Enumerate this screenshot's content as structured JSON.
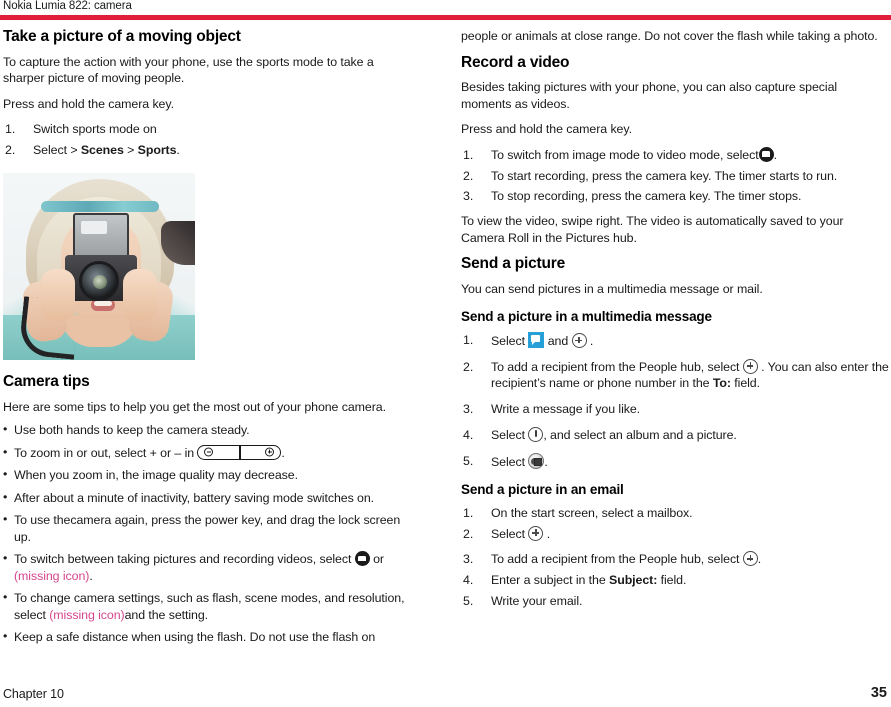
{
  "runhead": "Nokia Lumia 822: camera",
  "accent_color": "#e01f38",
  "missing_icon_color": "#d6468f",
  "left_column": {
    "heading": "Take a picture of a moving object",
    "intro": "To capture the action with your phone, use the sports mode to take a sharper picture of moving people.",
    "press_hold": "Press and hold the camera key.",
    "steps": [
      "Switch sports mode on",
      "Select > "
    ],
    "step2_parts": {
      "prefix": "Select > ",
      "bold1": "Scenes",
      "mid": " > ",
      "bold2": "Sports",
      "suffix": "."
    },
    "photo_alt": "person holding a camera up to their face",
    "tips_heading": "Camera tips",
    "tips_intro": "Here are some tips to help you get the most out of your phone camera.",
    "tips": {
      "t1": "Use both hands to keep the camera steady.",
      "t2_before": "To zoom in or out, select + or – in ",
      "t2_after": ".",
      "t3": "When you zoom in, the image quality may decrease.",
      "t4": "After about a minute of inactivity, battery saving mode switches on.",
      "t5": "To use thecamera again, press the power key, and drag the lock screen up.",
      "t6_before": "To switch between taking pictures and recording videos, select ",
      "t6_mid": " or ",
      "t6_missing": "(missing icon)",
      "t6_after": ".",
      "t7_before": "To change camera settings, such as flash, scene modes, and resolution, select ",
      "t7_missing": "(missing icon)",
      "t7_after": "and the setting.",
      "t8": "Keep a safe distance when using the flash. Do not use the flash on"
    }
  },
  "right_column": {
    "continuation": "people or animals at close range. Do not cover the flash while taking a photo.",
    "record_heading": "Record a video",
    "record_intro": "Besides taking pictures with your phone, you can also capture special moments as videos.",
    "record_press": "Press and hold the camera key.",
    "record_steps": {
      "s1_before": "To switch from image mode to video mode, select",
      "s1_after": ".",
      "s2": "To start recording, press the camera key. The timer starts to run.",
      "s3": "To stop recording, press the camera key. The timer stops."
    },
    "record_note": "To view the video, swipe right. The video is automatically saved to your Camera Roll in the Pictures hub.",
    "send_heading": "Send a picture",
    "send_intro": "You can send pictures in a multimedia message or mail.",
    "mms_heading": "Send a picture in a multimedia message",
    "mms_steps": {
      "s1_before": "Select ",
      "s1_mid": " and ",
      "s1_after": " .",
      "s2_before": "To add a recipient from the People hub, select ",
      "s2_mid": " . You can also enter the recipient’s name or phone number in the ",
      "s2_bold": "To:",
      "s2_after": " field.",
      "s3": "Write a message if you like.",
      "s4_before": "Select ",
      "s4_after": ", and select an album and a picture.",
      "s5_before": "Select ",
      "s5_after": "."
    },
    "email_heading": "Send a picture in an email",
    "email_steps": {
      "s1": "On the start screen, select a mailbox.",
      "s2_before": "Select ",
      "s2_after": " .",
      "s3_before": "To add a recipient from the People hub, select ",
      "s3_after": ".",
      "s4_before": "Enter a subject in the ",
      "s4_bold": "Subject:",
      "s4_after": " field.",
      "s5": "Write your email."
    }
  },
  "footer": {
    "chapter": "Chapter 10",
    "page_number": "35"
  }
}
